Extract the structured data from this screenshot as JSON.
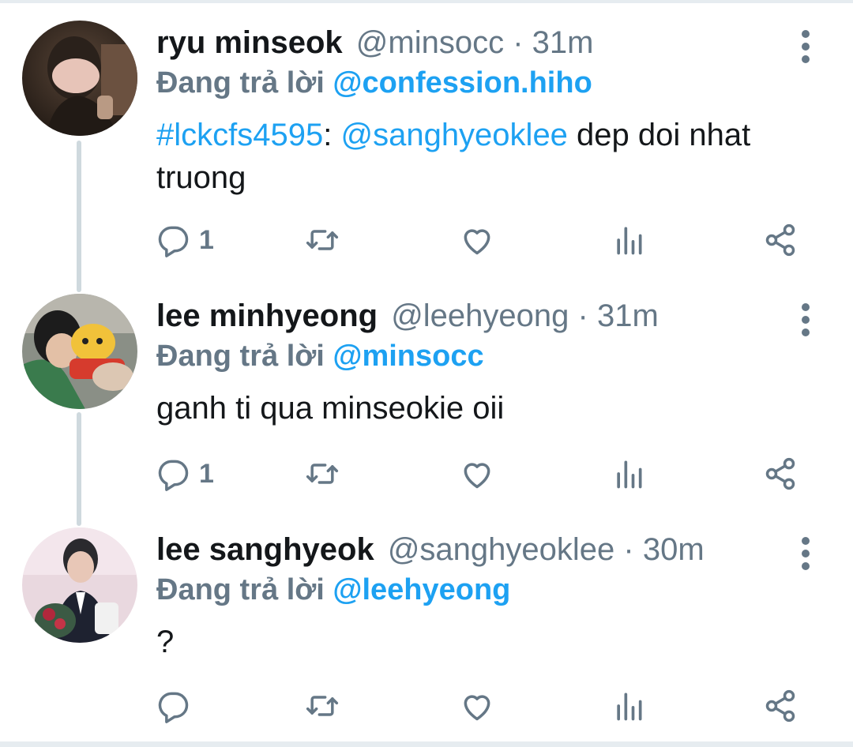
{
  "colors": {
    "link": "#1da1f2",
    "secondary": "#657786",
    "text": "#14171a",
    "thread_line": "#cfd9de"
  },
  "tweets": [
    {
      "name": "ryu minseok",
      "handle": "@minsocc",
      "separator": "·",
      "time": "31m",
      "replying_label": "Đang trả lời",
      "replying_to": "@confession.hiho",
      "body_hashtag": "#lckcfs4595",
      "body_colon": ": ",
      "body_mention": "@sanghyeoklee",
      "body_text": " dep doi nhat",
      "body_text_line2": "truong",
      "reply_count": "1",
      "icons": [
        "reply-icon",
        "retweet-icon",
        "like-icon",
        "analytics-icon",
        "share-icon"
      ]
    },
    {
      "name": "lee minhyeong",
      "handle": "@leehyeong",
      "separator": "·",
      "time": "31m",
      "replying_label": "Đang trả lời",
      "replying_to": "@minsocc",
      "body_text": "ganh ti qua minseokie oii",
      "reply_count": "1",
      "icons": [
        "reply-icon",
        "retweet-icon",
        "like-icon",
        "analytics-icon",
        "share-icon"
      ]
    },
    {
      "name": "lee sanghyeok",
      "handle": "@sanghyeoklee",
      "separator": "·",
      "time": "30m",
      "replying_label": "Đang trả lời",
      "replying_to": "@leehyeong",
      "body_text": "?",
      "reply_count": "",
      "icons": [
        "reply-icon",
        "retweet-icon",
        "like-icon",
        "analytics-icon",
        "share-icon"
      ]
    }
  ]
}
